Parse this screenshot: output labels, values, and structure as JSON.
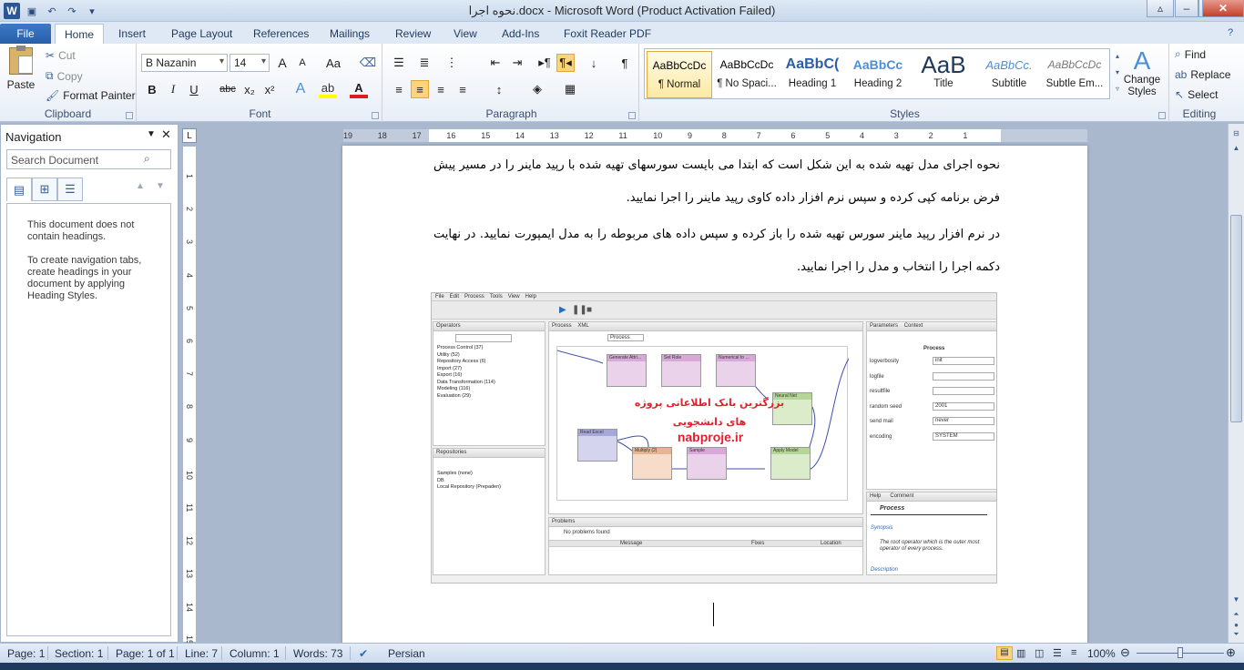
{
  "window": {
    "title": "نحوه اجرا.docx  -  Microsoft Word (Product Activation Failed)",
    "controls": {
      "min": "–",
      "restore": "❐",
      "close": "✕"
    }
  },
  "quick_access": [
    "save-icon",
    "undo-icon",
    "redo-icon",
    "customize-icon"
  ],
  "tabs": [
    "File",
    "Home",
    "Insert",
    "Page Layout",
    "References",
    "Mailings",
    "Review",
    "View",
    "Add-Ins",
    "Foxit Reader PDF"
  ],
  "ribbon": {
    "clipboard": {
      "label": "Clipboard",
      "paste": "Paste",
      "cut": "Cut",
      "copy": "Copy",
      "format_painter": "Format Painter"
    },
    "font": {
      "label": "Font",
      "family": "B Nazanin",
      "size": "14",
      "bold": "B",
      "italic": "I",
      "underline": "U",
      "strike": "abc",
      "sub": "x₂",
      "sup": "x²",
      "grow": "A",
      "shrink": "A",
      "case": "Aa"
    },
    "paragraph": {
      "label": "Paragraph"
    },
    "styles": {
      "label": "Styles",
      "items": [
        {
          "preview": "AaBbCcDc",
          "name": "¶ Normal"
        },
        {
          "preview": "AaBbCcDc",
          "name": "¶ No Spaci..."
        },
        {
          "preview": "AaBbC(",
          "name": "Heading 1"
        },
        {
          "preview": "AaBbCc",
          "name": "Heading 2"
        },
        {
          "preview": "AaB",
          "name": "Title"
        },
        {
          "preview": "AaBbCc.",
          "name": "Subtitle"
        },
        {
          "preview": "AaBbCcDc",
          "name": "Subtle Em..."
        }
      ],
      "change_styles": "Change Styles"
    },
    "editing": {
      "label": "Editing",
      "find": "Find",
      "replace": "Replace",
      "select": "Select"
    }
  },
  "navigation": {
    "title": "Navigation",
    "search_placeholder": "Search Document",
    "msg1": "This document does not contain headings.",
    "msg2": "To create navigation tabs, create headings in your document by applying Heading Styles."
  },
  "ruler": {
    "h_ticks": [
      "19",
      "18",
      "17",
      "16",
      "15",
      "14",
      "13",
      "12",
      "11",
      "10",
      "9",
      "8",
      "7",
      "6",
      "5",
      "4",
      "3",
      "2",
      "1"
    ],
    "v_ticks": [
      "1",
      "2",
      "3",
      "4",
      "5",
      "6",
      "7",
      "8",
      "9",
      "10",
      "11",
      "12",
      "13",
      "14",
      "15"
    ]
  },
  "document": {
    "para1": "نحوه اجرای مدل تهیه شده به این شکل است که ابتدا می بایست سورسهای تهیه شده با رپید ماینر را در مسیر پیش فرض برنامه کپی کرده و سپس نرم افزار داده کاوی رپید ماینر را اجرا نمایید.",
    "para2": "در نرم افزار رپید ماینر سورس تهیه شده را باز کرده و سپس داده های مربوطه را به مدل ایمپورت نمایید. در نهایت دکمه اجرا را انتخاب و مدل را اجرا نمایید."
  },
  "screenshot": {
    "menu": [
      "File",
      "Edit",
      "Process",
      "Tools",
      "View",
      "Help"
    ],
    "operators_tab": "Operators",
    "operator_tree": [
      "Process Control (37)",
      "Utility (52)",
      "Repository Access (6)",
      "Import (27)",
      "Export (16)",
      "Data Transformation (114)",
      "Modeling (116)",
      "Evaluation (29)"
    ],
    "repositories_tab": "Repositories",
    "repo_tree": [
      "Samples (none)",
      "DB",
      "Local Repository (Prepaden)"
    ],
    "process_tab": "Process",
    "xml_tab": "XML",
    "breadcrumb": "Process",
    "operators": [
      "Generate Attri...",
      "Set Role",
      "Numerical to ...",
      "Neural Net",
      "Read Excel",
      "Multiply (2)",
      "Sample",
      "Apply Model"
    ],
    "watermark_text": "بزرگترین بانک اطلاعاتی پروژه های دانشجویی",
    "watermark_url": "nabproje.ir",
    "problems_tab": "Problems",
    "no_problems": "No problems found",
    "problem_cols": [
      "Message",
      "Fixes",
      "Location"
    ],
    "parameters_tab": "Parameters",
    "context_tab": "Context",
    "param_title": "Process",
    "params": [
      {
        "name": "logverbosity",
        "value": "init"
      },
      {
        "name": "logfile",
        "value": ""
      },
      {
        "name": "resultfile",
        "value": ""
      },
      {
        "name": "random seed",
        "value": "2001"
      },
      {
        "name": "send mail",
        "value": "never"
      },
      {
        "name": "encoding",
        "value": "SYSTEM"
      }
    ],
    "help_tab": "Help",
    "comment_tab": "Comment",
    "help_title": "Process",
    "synopsis": "Synopsis",
    "help_text": "The root operator which is the outer most operator of every process.",
    "description": "Description"
  },
  "status": {
    "page": "Page: 1",
    "section": "Section: 1",
    "pages": "Page: 1 of 1",
    "line": "Line: 7",
    "column": "Column: 1",
    "words": "Words: 73",
    "language": "Persian",
    "zoom": "100%",
    "zoom_level": 1.0
  }
}
